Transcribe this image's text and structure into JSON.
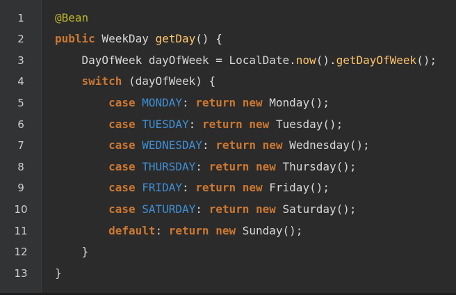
{
  "editor": {
    "line_numbers": [
      "1",
      "2",
      "3",
      "4",
      "5",
      "6",
      "7",
      "8",
      "9",
      "10",
      "11",
      "12",
      "13"
    ],
    "lines": [
      [
        {
          "t": "@Bean",
          "c": "ann"
        }
      ],
      [
        {
          "t": "public",
          "c": "kw"
        },
        {
          "t": " WeekDay ",
          "c": "plain"
        },
        {
          "t": "getDay",
          "c": "fn"
        },
        {
          "t": "() {",
          "c": "punc"
        }
      ],
      [
        {
          "t": "    DayOfWeek dayOfWeek = LocalDate.",
          "c": "plain"
        },
        {
          "t": "now",
          "c": "fn"
        },
        {
          "t": "().",
          "c": "punc"
        },
        {
          "t": "getDayOfWeek",
          "c": "fn"
        },
        {
          "t": "();",
          "c": "punc"
        }
      ],
      [
        {
          "t": "    ",
          "c": "plain"
        },
        {
          "t": "switch",
          "c": "kw"
        },
        {
          "t": " (dayOfWeek) {",
          "c": "plain"
        }
      ],
      [
        {
          "t": "        ",
          "c": "plain"
        },
        {
          "t": "case",
          "c": "kw"
        },
        {
          "t": " ",
          "c": "plain"
        },
        {
          "t": "MONDAY",
          "c": "const"
        },
        {
          "t": ": ",
          "c": "punc"
        },
        {
          "t": "return",
          "c": "kw"
        },
        {
          "t": " ",
          "c": "plain"
        },
        {
          "t": "new",
          "c": "kw"
        },
        {
          "t": " Monday();",
          "c": "plain"
        }
      ],
      [
        {
          "t": "        ",
          "c": "plain"
        },
        {
          "t": "case",
          "c": "kw"
        },
        {
          "t": " ",
          "c": "plain"
        },
        {
          "t": "TUESDAY",
          "c": "const"
        },
        {
          "t": ": ",
          "c": "punc"
        },
        {
          "t": "return",
          "c": "kw"
        },
        {
          "t": " ",
          "c": "plain"
        },
        {
          "t": "new",
          "c": "kw"
        },
        {
          "t": " Tuesday();",
          "c": "plain"
        }
      ],
      [
        {
          "t": "        ",
          "c": "plain"
        },
        {
          "t": "case",
          "c": "kw"
        },
        {
          "t": " ",
          "c": "plain"
        },
        {
          "t": "WEDNESDAY",
          "c": "const"
        },
        {
          "t": ": ",
          "c": "punc"
        },
        {
          "t": "return",
          "c": "kw"
        },
        {
          "t": " ",
          "c": "plain"
        },
        {
          "t": "new",
          "c": "kw"
        },
        {
          "t": " Wednesday();",
          "c": "plain"
        }
      ],
      [
        {
          "t": "        ",
          "c": "plain"
        },
        {
          "t": "case",
          "c": "kw"
        },
        {
          "t": " ",
          "c": "plain"
        },
        {
          "t": "THURSDAY",
          "c": "const"
        },
        {
          "t": ": ",
          "c": "punc"
        },
        {
          "t": "return",
          "c": "kw"
        },
        {
          "t": " ",
          "c": "plain"
        },
        {
          "t": "new",
          "c": "kw"
        },
        {
          "t": " Thursday();",
          "c": "plain"
        }
      ],
      [
        {
          "t": "        ",
          "c": "plain"
        },
        {
          "t": "case",
          "c": "kw"
        },
        {
          "t": " ",
          "c": "plain"
        },
        {
          "t": "FRIDAY",
          "c": "const"
        },
        {
          "t": ": ",
          "c": "punc"
        },
        {
          "t": "return",
          "c": "kw"
        },
        {
          "t": " ",
          "c": "plain"
        },
        {
          "t": "new",
          "c": "kw"
        },
        {
          "t": " Friday();",
          "c": "plain"
        }
      ],
      [
        {
          "t": "        ",
          "c": "plain"
        },
        {
          "t": "case",
          "c": "kw"
        },
        {
          "t": " ",
          "c": "plain"
        },
        {
          "t": "SATURDAY",
          "c": "const"
        },
        {
          "t": ": ",
          "c": "punc"
        },
        {
          "t": "return",
          "c": "kw"
        },
        {
          "t": " ",
          "c": "plain"
        },
        {
          "t": "new",
          "c": "kw"
        },
        {
          "t": " Saturday();",
          "c": "plain"
        }
      ],
      [
        {
          "t": "        ",
          "c": "plain"
        },
        {
          "t": "default",
          "c": "kw"
        },
        {
          "t": ": ",
          "c": "punc"
        },
        {
          "t": "return",
          "c": "kw"
        },
        {
          "t": " ",
          "c": "plain"
        },
        {
          "t": "new",
          "c": "kw"
        },
        {
          "t": " Sunday();",
          "c": "plain"
        }
      ],
      [
        {
          "t": "    }",
          "c": "plain"
        }
      ],
      [
        {
          "t": "}",
          "c": "plain"
        }
      ]
    ]
  },
  "colors": {
    "background": "#2b2b2b",
    "gutter": "#313335",
    "keyword": "#cc7832",
    "annotation": "#bbb529",
    "function": "#ffc66d",
    "constant": "#3f8fd6",
    "plain": "#d8d8d8"
  }
}
